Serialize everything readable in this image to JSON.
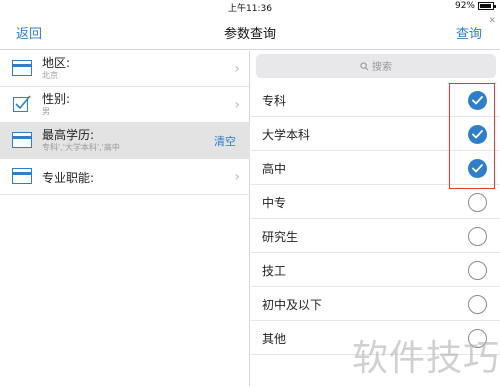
{
  "status_bar": {
    "time": "上午11:36",
    "battery": "92%"
  },
  "nav": {
    "back": "返回",
    "title": "参数查询",
    "query": "查询"
  },
  "left_rows": [
    {
      "title": "地区:",
      "subtitle": "北京",
      "icon": "card-icon",
      "trailing": "chevron"
    },
    {
      "title": "性别:",
      "subtitle": "男",
      "icon": "checkbox-icon",
      "trailing": "chevron"
    },
    {
      "title": "最高学历:",
      "subtitle": "专科','大学本科','高中",
      "icon": "card-icon",
      "trailing": "clear",
      "clear_label": "清空",
      "selected": true
    },
    {
      "title": "专业职能:",
      "subtitle": "",
      "icon": "card-icon",
      "trailing": "chevron"
    }
  ],
  "search": {
    "placeholder": "搜索"
  },
  "options": [
    {
      "label": "专科",
      "checked": true
    },
    {
      "label": "大学本科",
      "checked": true
    },
    {
      "label": "高中",
      "checked": true
    },
    {
      "label": "中专",
      "checked": false
    },
    {
      "label": "研究生",
      "checked": false
    },
    {
      "label": "技工",
      "checked": false
    },
    {
      "label": "初中及以下",
      "checked": false
    },
    {
      "label": "其他",
      "checked": false
    }
  ],
  "watermark": "软件技巧",
  "colors": {
    "accent": "#2f7ec9",
    "highlight": "#e33333",
    "selected_row": "#e3e3e3"
  }
}
